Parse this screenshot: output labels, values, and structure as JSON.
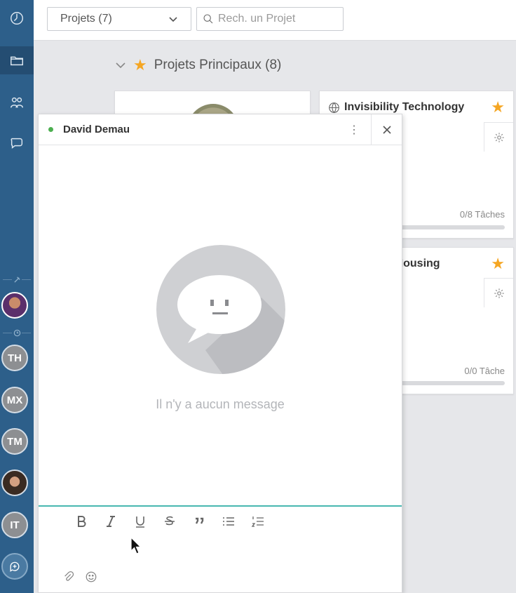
{
  "sidebar": {
    "avatars": [
      {
        "initials": "TH"
      },
      {
        "initials": "MX"
      },
      {
        "initials": "TM"
      },
      {
        "initials": "IT"
      }
    ]
  },
  "topbar": {
    "projects_select": "Projets (7)",
    "search_placeholder": "Rech. un Projet"
  },
  "section": {
    "title": "Projets Principaux (8)"
  },
  "cards": [
    {
      "title": "Invisibility Technology",
      "tasks": "0/8 Tâches"
    },
    {
      "title": "er Housing",
      "tasks": "0/0 Tâche"
    }
  ],
  "chat": {
    "name": "David Demau",
    "empty_message": "Il n'y a aucun message"
  },
  "colors": {
    "sidebar": "#2d5f8a",
    "accent_teal": "#48b7b0",
    "star": "#f5a623",
    "online": "#4caf50"
  }
}
